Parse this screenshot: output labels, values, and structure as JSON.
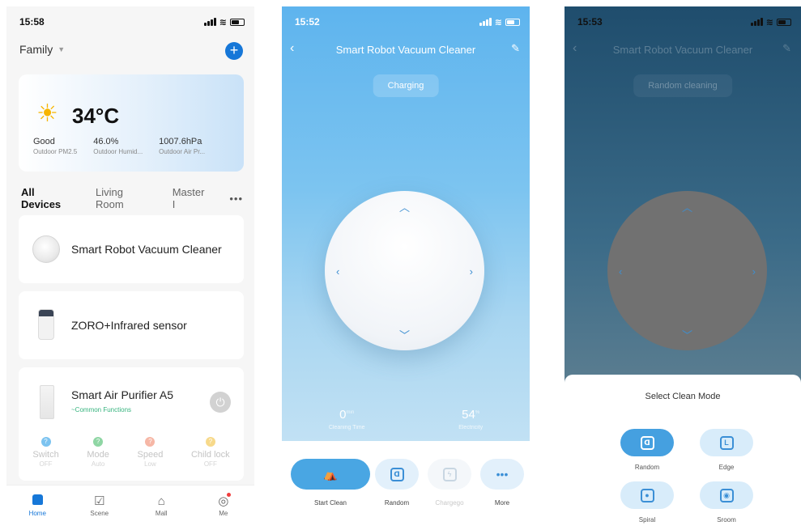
{
  "home": {
    "status_time": "15:58",
    "family_label": "Family",
    "weather": {
      "temp": "34°C",
      "stats": [
        {
          "value": "Good",
          "label": "Outdoor PM2.5"
        },
        {
          "value": "46.0%",
          "label": "Outdoor Humid..."
        },
        {
          "value": "1007.6hPa",
          "label": "Outdoor Air Pr..."
        }
      ]
    },
    "tabs": [
      "All Devices",
      "Living Room",
      "Master I"
    ],
    "tabs_more": "•••",
    "devices": [
      {
        "name": "Smart Robot Vacuum Cleaner"
      },
      {
        "name": "ZORO+Infrared sensor"
      },
      {
        "name": "Smart Air Purifier A5",
        "sub": "~Common Functions"
      }
    ],
    "functions": [
      {
        "label": "Switch",
        "state": "OFF",
        "color": "#7cc3f0"
      },
      {
        "label": "Mode",
        "state": "Auto",
        "color": "#8fd6a4"
      },
      {
        "label": "Speed",
        "state": "Low",
        "color": "#f6b7a6"
      },
      {
        "label": "Child lock",
        "state": "OFF",
        "color": "#f7d98a"
      }
    ],
    "nav": [
      "Home",
      "Scene",
      "Mall",
      "Me"
    ]
  },
  "device": {
    "status_time": "15:52",
    "title": "Smart Robot Vacuum Cleaner",
    "status_pill": "Charging",
    "cleaning_time": {
      "value": "0",
      "unit": "min",
      "label": "Cleaning Time"
    },
    "electricity": {
      "value": "54",
      "unit": "%",
      "label": "Electricity"
    },
    "controls": [
      "Start Clean",
      "Random",
      "Chargego",
      "More"
    ]
  },
  "modes": {
    "status_time": "15:53",
    "title": "Smart Robot Vacuum Cleaner",
    "status_pill": "Random cleaning",
    "sheet_title": "Select Clean Mode",
    "options": [
      "Random",
      "Edge",
      "Spiral",
      "Sroom"
    ]
  },
  "colors": {
    "accent": "#1677d8",
    "active_blue": "#45a0e0",
    "green": "#36b37e"
  }
}
